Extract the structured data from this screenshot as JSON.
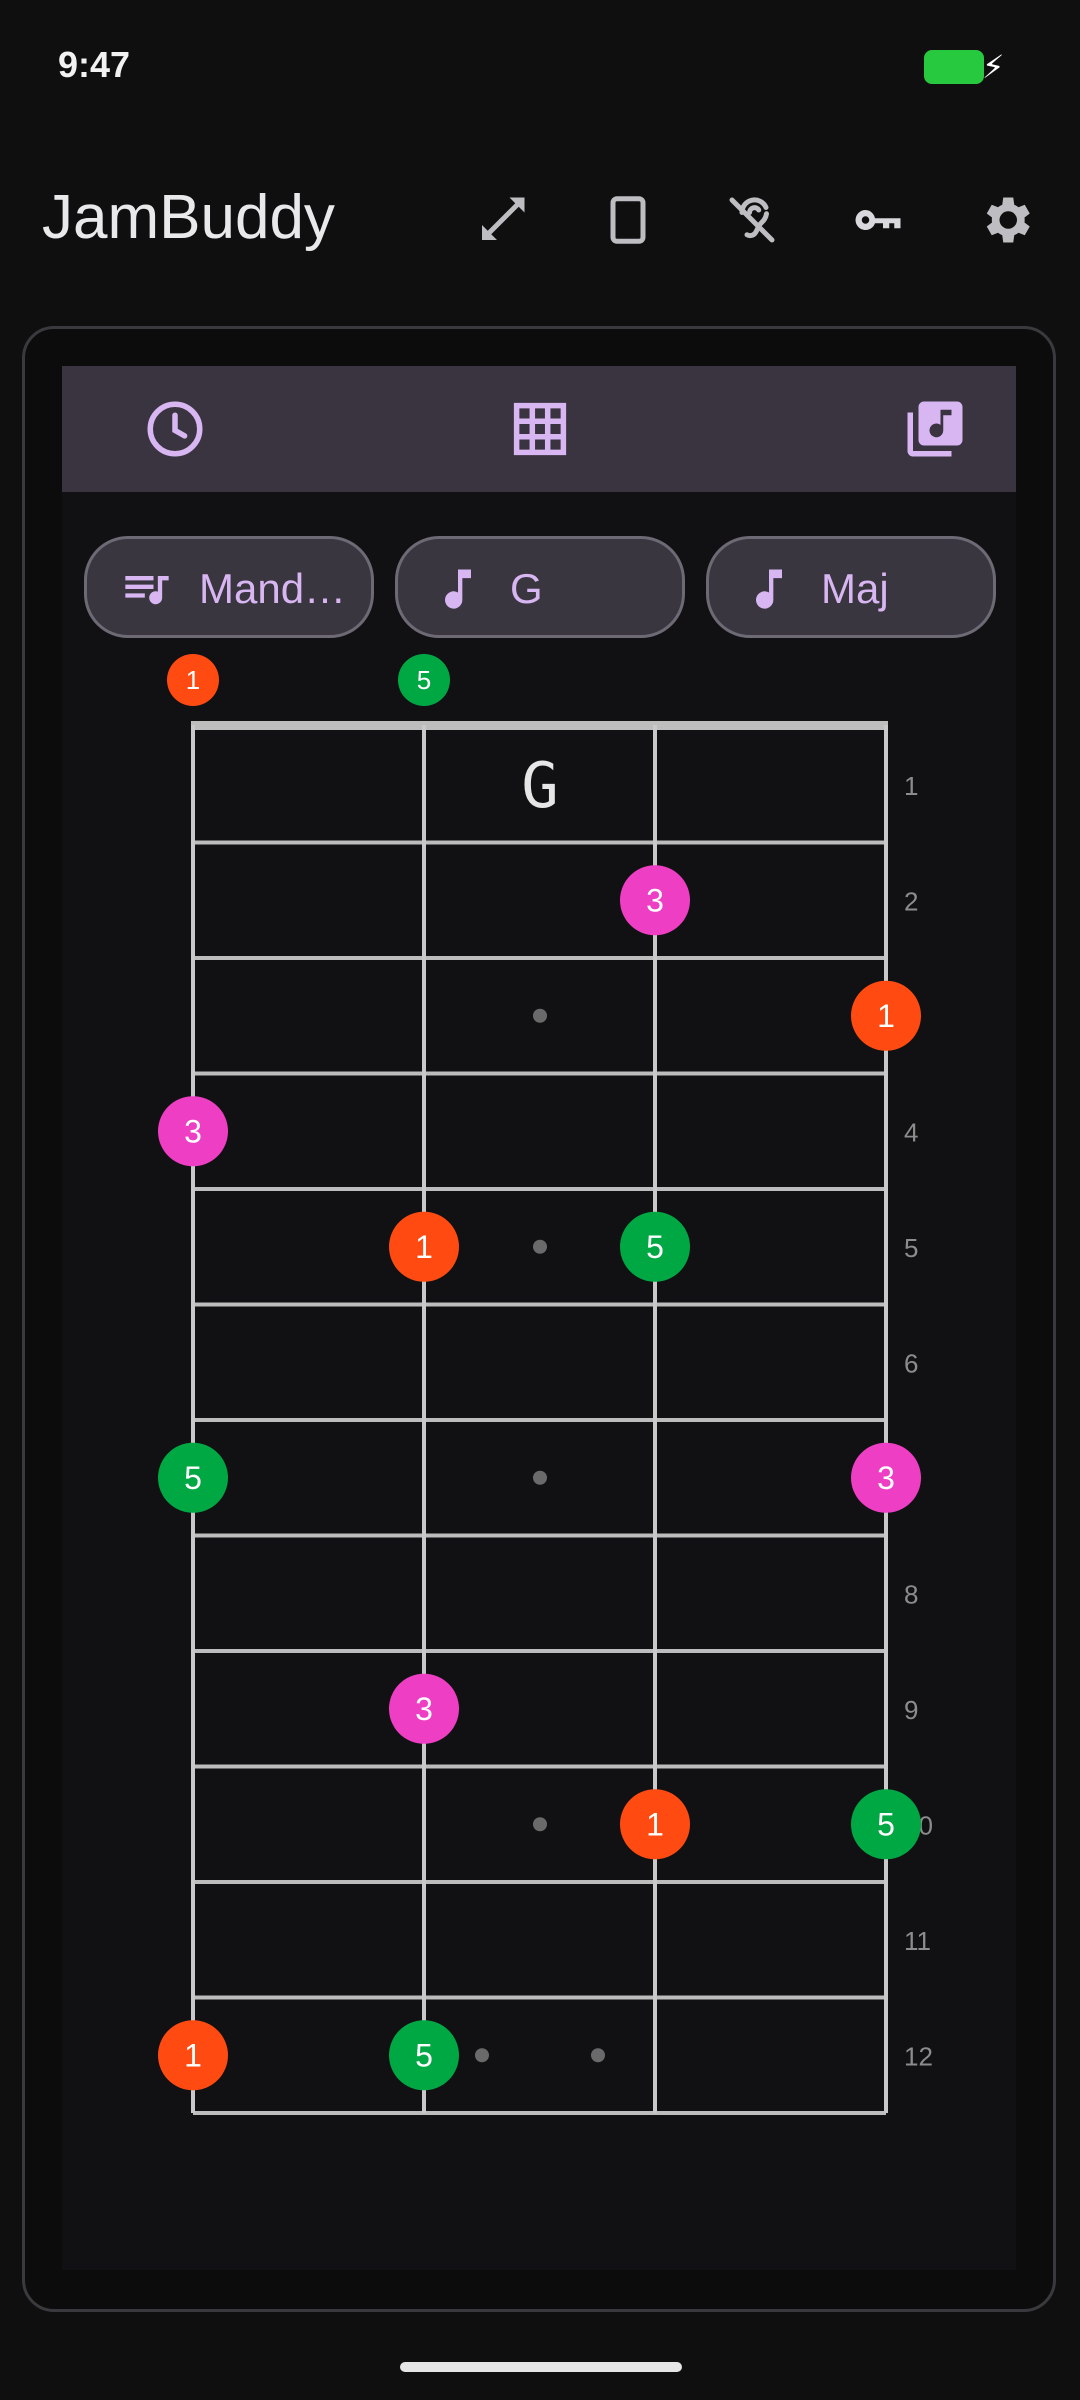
{
  "status": {
    "time": "9:47"
  },
  "app": {
    "title": "JamBuddy"
  },
  "chips": {
    "instrument": "Mand…",
    "key": "G",
    "quality": "Maj"
  },
  "fretboard": {
    "chord_label": "G",
    "fret_numbers": [
      "1",
      "2",
      "3",
      "4",
      "5",
      "6",
      "7",
      "8",
      "9",
      "10",
      "11",
      "12"
    ],
    "open_markers": [
      {
        "string": 0,
        "label": "1",
        "color": "#ff4b12"
      },
      {
        "string": 1,
        "label": "5",
        "color": "#00a844"
      }
    ],
    "notes": [
      {
        "string": 2,
        "fret": 2,
        "label": "3",
        "color": "#ee3fc4"
      },
      {
        "string": 3,
        "fret": 3,
        "label": "1",
        "color": "#ff4b12"
      },
      {
        "string": 0,
        "fret": 4,
        "label": "3",
        "color": "#ee3fc4"
      },
      {
        "string": 1,
        "fret": 5,
        "label": "1",
        "color": "#ff4b12"
      },
      {
        "string": 2,
        "fret": 5,
        "label": "5",
        "color": "#00a844"
      },
      {
        "string": 0,
        "fret": 7,
        "label": "5",
        "color": "#00a844"
      },
      {
        "string": 3,
        "fret": 7,
        "label": "3",
        "color": "#ee3fc4"
      },
      {
        "string": 1,
        "fret": 9,
        "label": "3",
        "color": "#ee3fc4"
      },
      {
        "string": 2,
        "fret": 10,
        "label": "1",
        "color": "#ff4b12"
      },
      {
        "string": 3,
        "fret": 10,
        "label": "5",
        "color": "#00a844"
      },
      {
        "string": 0,
        "fret": 12,
        "label": "1",
        "color": "#ff4b12"
      },
      {
        "string": 1,
        "fret": 12,
        "label": "5",
        "color": "#00a844"
      }
    ],
    "inlay_frets": [
      3,
      5,
      7,
      10
    ],
    "double_inlay_fret": 12
  },
  "colors": {
    "accent": "#d7b6f2",
    "root": "#ff4b12",
    "fifth": "#00a844",
    "third": "#ee3fc4"
  }
}
